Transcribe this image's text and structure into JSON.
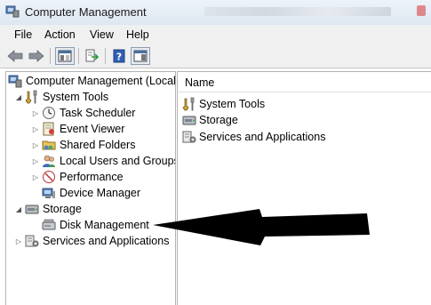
{
  "window": {
    "title": "Computer Management"
  },
  "menu": {
    "items": [
      "File",
      "Action",
      "View",
      "Help"
    ]
  },
  "toolbar": {
    "buttons": [
      "back-arrow-icon",
      "forward-arrow-icon",
      "show-hide-tree-icon",
      "export-list-icon",
      "help-icon",
      "show-action-pane-icon"
    ]
  },
  "tree": {
    "root": "Computer Management (Local",
    "system_tools": "System Tools",
    "system_tools_children": [
      "Task Scheduler",
      "Event Viewer",
      "Shared Folders",
      "Local Users and Groups",
      "Performance",
      "Device Manager"
    ],
    "storage": "Storage",
    "storage_children": [
      "Disk Management"
    ],
    "services": "Services and Applications"
  },
  "list": {
    "column_name": "Name",
    "items": [
      "System Tools",
      "Storage",
      "Services and Applications"
    ]
  },
  "colors": {
    "arrow": "#000000",
    "titlebar": "#dde7f2",
    "chrome": "#f0f0f0"
  }
}
